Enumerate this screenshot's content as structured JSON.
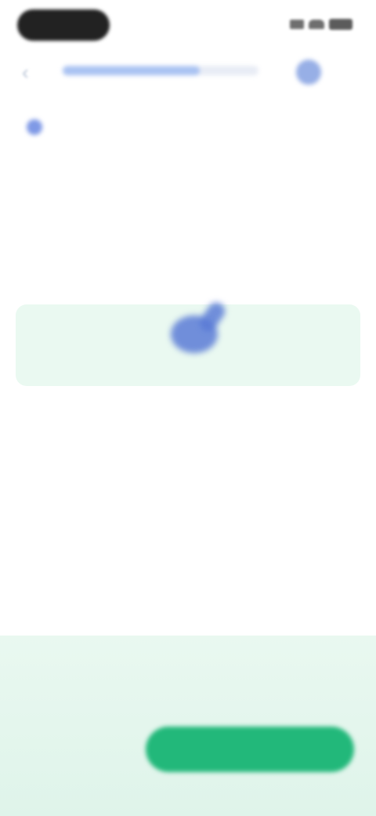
{
  "status_bar": {
    "time": "",
    "icons": [
      "signal-icon",
      "wifi-icon",
      "battery-icon"
    ]
  },
  "header": {
    "back_icon": "chevron-left-icon",
    "progress": 0.7,
    "heart_icon": "heart-icon",
    "hearts_count": ""
  },
  "question": {
    "tag_icon": "sparkle-icon",
    "tag_label": "",
    "text": ""
  },
  "options": [
    {
      "text": "",
      "state": "default"
    },
    {
      "text": "",
      "state": "selected"
    },
    {
      "text": "",
      "state": "default"
    },
    {
      "text": "",
      "state": "default"
    }
  ],
  "result_panel": {
    "title": "",
    "subtitle": "",
    "report_label": "",
    "continue_label": "",
    "colors": {
      "accent": "#22b87a",
      "panel_bg": "#e6f7ee",
      "selected_option_bg": "#eaf9f1"
    }
  }
}
